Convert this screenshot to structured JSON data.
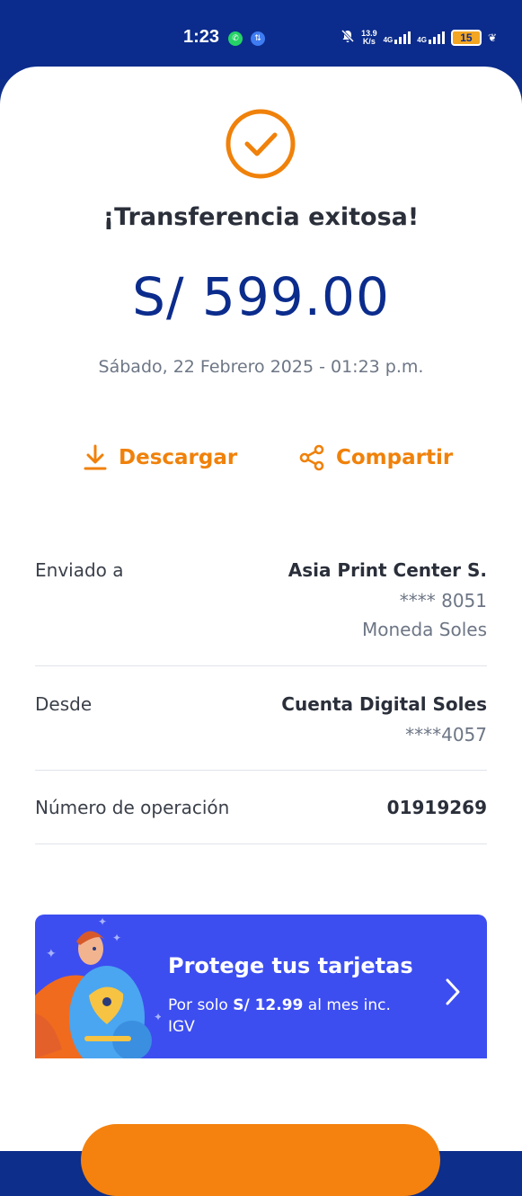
{
  "status_bar": {
    "time": "1:23",
    "net_speed_value": "13.9",
    "net_speed_unit": "K/s",
    "sim1_label": "4G",
    "sim2_label": "4G",
    "battery": "15"
  },
  "receipt": {
    "title": "¡Transferencia exitosa!",
    "amount": "S/ 599.00",
    "datetime": "Sábado, 22 Febrero 2025 - 01:23 p.m."
  },
  "actions": {
    "download_label": "Descargar",
    "share_label": "Compartir"
  },
  "details": {
    "sent_to": {
      "label": "Enviado a",
      "name": "Asia Print Center S.",
      "account": "**** 8051",
      "currency": "Moneda Soles"
    },
    "from": {
      "label": "Desde",
      "account_name": "Cuenta Digital Soles",
      "account_number": "****4057"
    },
    "operation": {
      "label": "Número de operación",
      "number": "01919269"
    }
  },
  "promo": {
    "title": "Protege tus tarjetas",
    "text_prefix": "Por solo ",
    "price": "S/ 12.99",
    "text_suffix": " al mes inc. IGV"
  },
  "colors": {
    "brand_blue": "#0b2c8c",
    "accent_orange": "#f0810a",
    "promo_blue": "#3d4ef0"
  }
}
